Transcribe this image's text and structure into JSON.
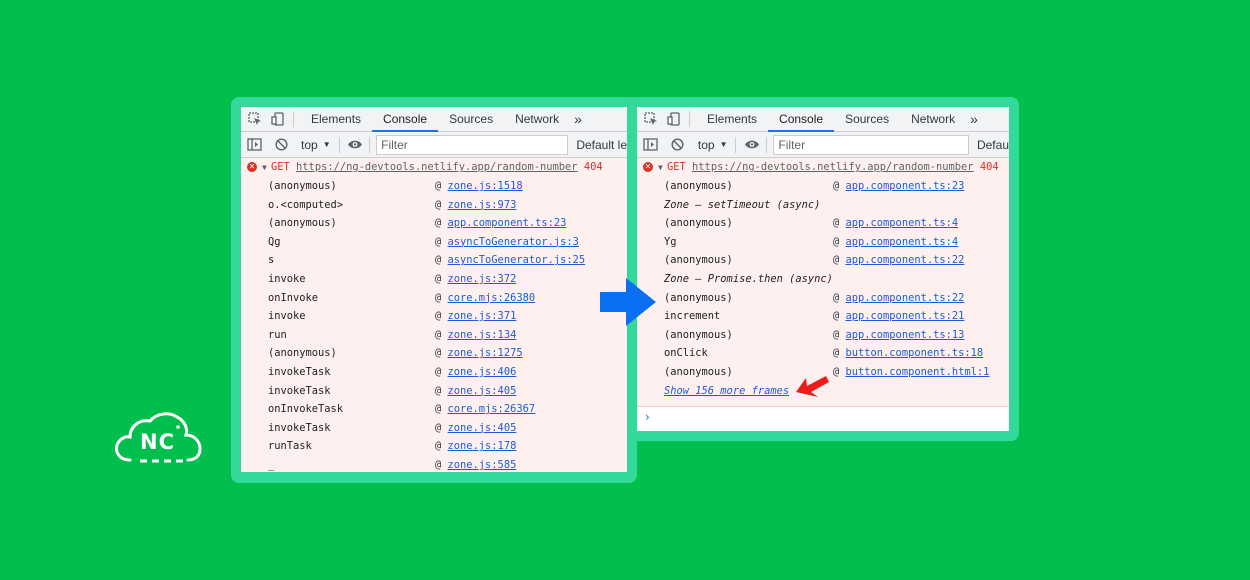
{
  "logo": {
    "text": "NC"
  },
  "tabs": [
    "Elements",
    "Console",
    "Sources",
    "Network"
  ],
  "toolbar": {
    "context": "top",
    "filter_placeholder": "Filter",
    "levels_left": "Default le",
    "levels_right": "Defau"
  },
  "error": {
    "method": "GET",
    "url": "https://ng-devtools.netlify.app/random-number",
    "status": "404"
  },
  "left_frames": [
    {
      "fn": "(anonymous)",
      "src": "zone.js:1518"
    },
    {
      "fn": "o.<computed>",
      "src": "zone.js:973"
    },
    {
      "fn": "(anonymous)",
      "src": "app.component.ts:23"
    },
    {
      "fn": "Qg",
      "src": "asyncToGenerator.js:3"
    },
    {
      "fn": "s",
      "src": "asyncToGenerator.js:25"
    },
    {
      "fn": "invoke",
      "src": "zone.js:372"
    },
    {
      "fn": "onInvoke",
      "src": "core.mjs:26380"
    },
    {
      "fn": "invoke",
      "src": "zone.js:371"
    },
    {
      "fn": "run",
      "src": "zone.js:134"
    },
    {
      "fn": "(anonymous)",
      "src": "zone.js:1275"
    },
    {
      "fn": "invokeTask",
      "src": "zone.js:406"
    },
    {
      "fn": "invokeTask",
      "src": "zone.js:405"
    },
    {
      "fn": "onInvokeTask",
      "src": "core.mjs:26367"
    },
    {
      "fn": "invokeTask",
      "src": "zone.js:405"
    },
    {
      "fn": "runTask",
      "src": "zone.js:178"
    },
    {
      "fn": "_",
      "src": "zone.js:585"
    }
  ],
  "right_frames": [
    {
      "fn": "(anonymous)",
      "src": "app.component.ts:23"
    },
    {
      "async": "Zone — setTimeout (async)"
    },
    {
      "fn": "(anonymous)",
      "src": "app.component.ts:4"
    },
    {
      "fn": "Yg",
      "src": "app.component.ts:4"
    },
    {
      "fn": "(anonymous)",
      "src": "app.component.ts:22"
    },
    {
      "async": "Zone — Promise.then (async)"
    },
    {
      "fn": "(anonymous)",
      "src": "app.component.ts:22"
    },
    {
      "fn": "increment",
      "src": "app.component.ts:21"
    },
    {
      "fn": "(anonymous)",
      "src": "app.component.ts:13"
    },
    {
      "fn": "onClick",
      "src": "button.component.ts:18"
    },
    {
      "fn": "(anonymous)",
      "src": "button.component.html:1"
    }
  ],
  "show_more": "Show 156 more frames",
  "colors": {
    "background": "#00bf4d",
    "frame": "#33d99a",
    "arrow": "#0a6ff0",
    "pointer": "#ee1b1b"
  },
  "icons": [
    "inspect-icon",
    "device-toggle-icon",
    "more-tabs-icon",
    "sidebar-toggle-icon",
    "clear-console-icon",
    "eye-icon",
    "error-icon",
    "expand-triangle-icon",
    "blue-arrow-icon",
    "red-pointer-arrow-icon",
    "prompt-chevron-icon"
  ]
}
